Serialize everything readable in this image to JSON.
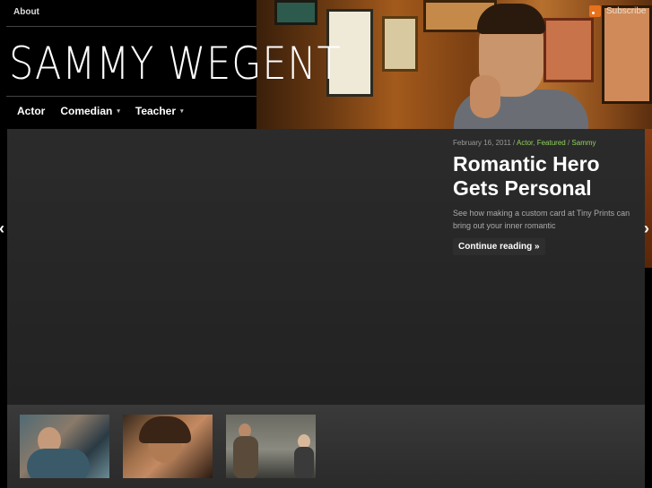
{
  "header": {
    "top_nav_about": "About",
    "subscribe_label": "Subscribe",
    "site_title": "SAMMY WEGENT",
    "nav": [
      {
        "label": "Actor",
        "has_dropdown": false
      },
      {
        "label": "Comedian",
        "has_dropdown": true
      },
      {
        "label": "Teacher",
        "has_dropdown": true
      }
    ],
    "dropdown_glyph": "▾"
  },
  "slider": {
    "meta_date": "February 16, 2011",
    "meta_sep1": " / ",
    "meta_cat1": "Actor",
    "meta_comma": ", ",
    "meta_cat2": "Featured",
    "meta_sep2": " / ",
    "meta_author": "Sammy",
    "post_title": "Romantic Hero Gets Personal",
    "excerpt": "See how making a custom card at Tiny Prints can bring out your inner romantic",
    "read_more": "Continue reading »",
    "prev_arrow": "‹",
    "next_arrow": "›"
  },
  "thumbnails": [
    {
      "alt": "thumbnail-1"
    },
    {
      "alt": "thumbnail-2"
    },
    {
      "alt": "thumbnail-3"
    }
  ],
  "colors": {
    "accent_category": "#8fd15a",
    "rss": "#e8711b",
    "background": "#000000"
  }
}
